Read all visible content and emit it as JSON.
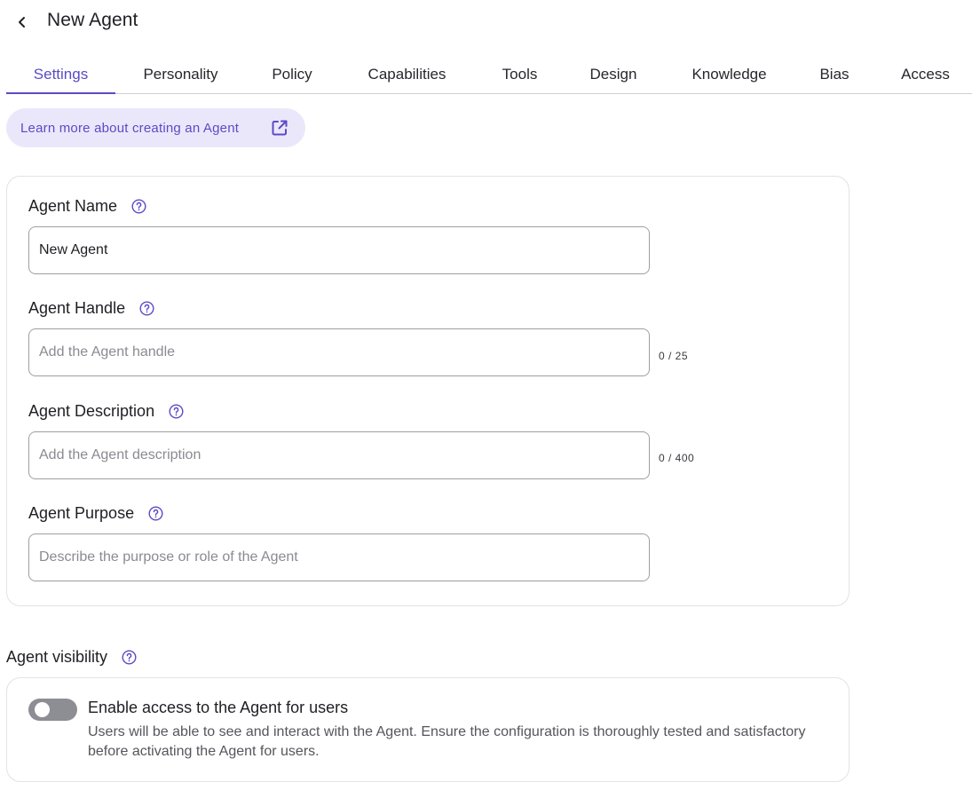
{
  "header": {
    "back_icon": "chevron-left-icon",
    "title": "New Agent"
  },
  "tabs": [
    {
      "label": "Settings",
      "active": true
    },
    {
      "label": "Personality",
      "active": false
    },
    {
      "label": "Policy",
      "active": false
    },
    {
      "label": "Capabilities",
      "active": false
    },
    {
      "label": "Tools",
      "active": false
    },
    {
      "label": "Design",
      "active": false
    },
    {
      "label": "Knowledge",
      "active": false
    },
    {
      "label": "Bias",
      "active": false
    },
    {
      "label": "Access",
      "active": false
    }
  ],
  "learn_more": {
    "label": "Learn more about creating an Agent",
    "icon": "external-link-icon"
  },
  "form": {
    "agent_name": {
      "label": "Agent Name",
      "value": "New Agent",
      "placeholder": ""
    },
    "agent_handle": {
      "label": "Agent Handle",
      "value": "",
      "placeholder": "Add the Agent handle",
      "counter": "0 / 25"
    },
    "agent_description": {
      "label": "Agent Description",
      "value": "",
      "placeholder": "Add the Agent description",
      "counter": "0 / 400"
    },
    "agent_purpose": {
      "label": "Agent Purpose",
      "value": "",
      "placeholder": "Describe the purpose or role of the Agent"
    }
  },
  "visibility": {
    "section_title": "Agent visibility",
    "toggle_label": "Enable access to the Agent for users",
    "toggle_on": false,
    "description": "Users will be able to see and interact with the Agent. Ensure the configuration is thoroughly tested and satisfactory before activating the Agent for users."
  },
  "colors": {
    "accent": "#5b4bc4",
    "accent_bg": "#ebe7fb",
    "toggle_off": "#8d8d94",
    "border": "#e2e2e8"
  }
}
